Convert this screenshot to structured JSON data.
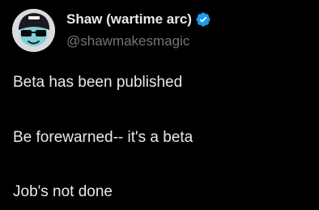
{
  "author": {
    "display_name": "Shaw (wartime arc)",
    "handle": "@shawmakesmagic",
    "verified": true,
    "verified_icon": "verified-badge-icon",
    "avatar_icon": "avatar-cartoon-sunglasses"
  },
  "tweet": {
    "lines": [
      "Beta has been published",
      "Be forewarned-- it's a beta",
      "Job's not done"
    ]
  },
  "colors": {
    "background": "#000000",
    "primary_text": "#e7e9ea",
    "secondary_text": "#71767b",
    "verified_blue": "#1d9bf0"
  }
}
